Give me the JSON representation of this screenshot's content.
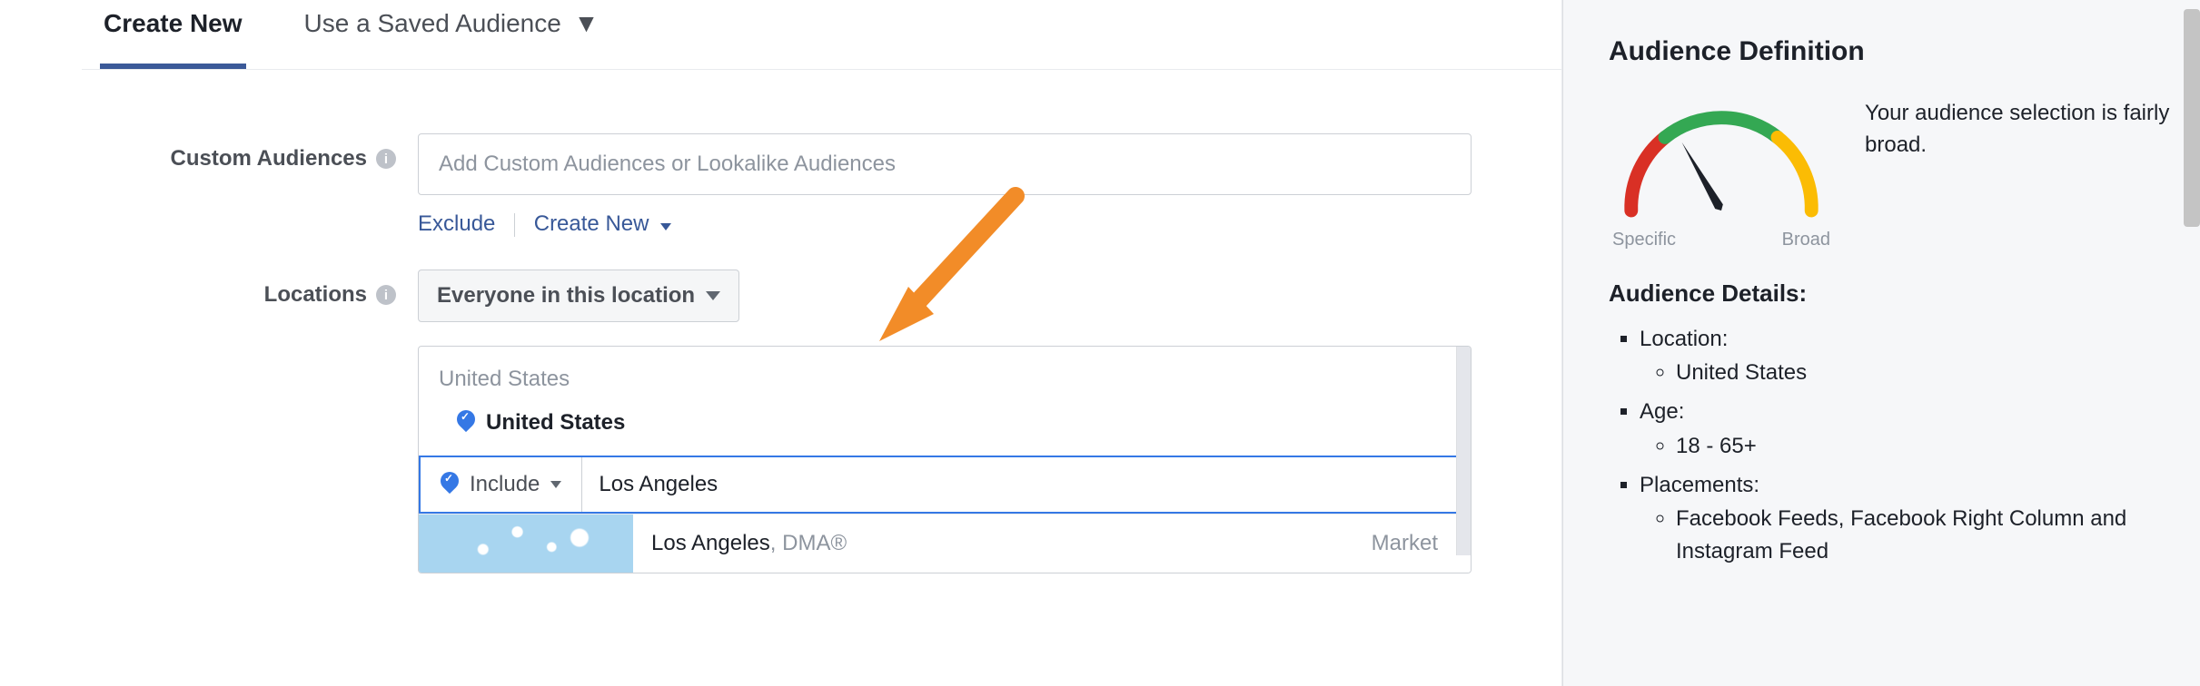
{
  "tabs": {
    "create_new": "Create New",
    "saved_audience": "Use a Saved Audience"
  },
  "custom_audiences": {
    "label": "Custom Audiences",
    "placeholder": "Add Custom Audiences or Lookalike Audiences",
    "exclude": "Exclude",
    "create_new": "Create New"
  },
  "locations": {
    "label": "Locations",
    "mode": "Everyone in this location",
    "country_group": "United States",
    "country": "United States",
    "include_label": "Include",
    "search_value": "Los Angeles",
    "suggestion_name": "Los Angeles",
    "suggestion_suffix": ", DMA®",
    "suggestion_type": "Market"
  },
  "side": {
    "title": "Audience Definition",
    "gauge_specific": "Specific",
    "gauge_broad": "Broad",
    "summary": "Your audience selection is fairly broad.",
    "details_title": "Audience Details:",
    "items": {
      "location_label": "Location:",
      "location_value": "United States",
      "age_label": "Age:",
      "age_value": "18 - 65+",
      "placements_label": "Placements:",
      "placements_value": "Facebook Feeds, Facebook Right Column and Instagram Feed"
    }
  }
}
